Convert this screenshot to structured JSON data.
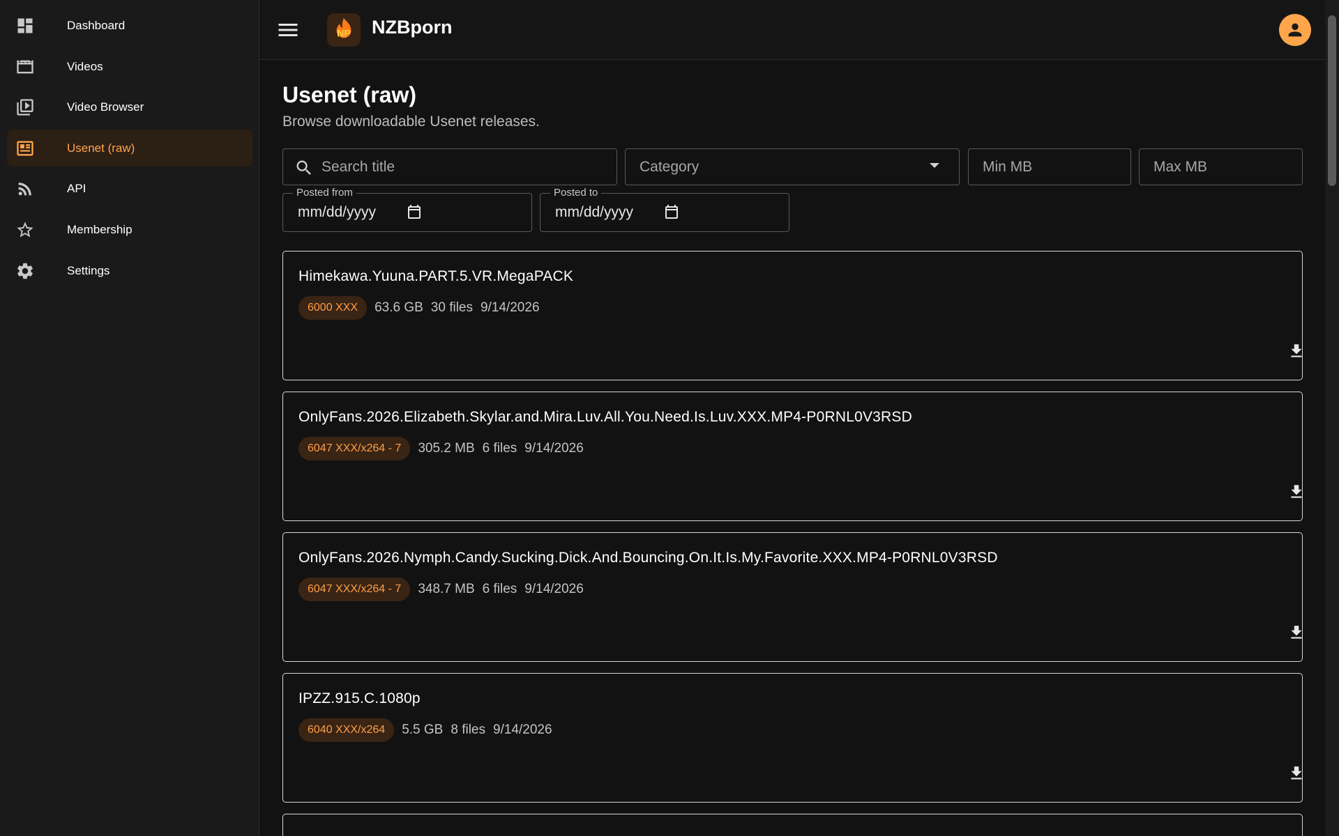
{
  "sidebar": {
    "items": [
      {
        "label": "Dashboard",
        "icon": "dashboard-icon"
      },
      {
        "label": "Videos",
        "icon": "clapperboard-icon"
      },
      {
        "label": "Video Browser",
        "icon": "video-library-icon"
      },
      {
        "label": "Usenet (raw)",
        "icon": "newspaper-icon",
        "active": true
      },
      {
        "label": "API",
        "icon": "rss-icon"
      },
      {
        "label": "Membership",
        "icon": "star-icon"
      },
      {
        "label": "Settings",
        "icon": "gear-icon"
      }
    ]
  },
  "header": {
    "brand": "NZBporn",
    "logo_text": "NP"
  },
  "page": {
    "title": "Usenet (raw)",
    "subtitle": "Browse downloadable Usenet releases."
  },
  "filters": {
    "search_placeholder": "Search title",
    "category_placeholder": "Category",
    "min_mb_placeholder": "Min MB",
    "max_mb_placeholder": "Max MB",
    "posted_from_label": "Posted from",
    "posted_from_value": "mm/dd/yyyy",
    "posted_to_label": "Posted to",
    "posted_to_value": "mm/dd/yyyy"
  },
  "releases": [
    {
      "title": "Himekawa.Yuuna.PART.5.VR.MegaPACK",
      "category": "6000 XXX",
      "size": "63.6 GB",
      "files": "30 files",
      "date": "9/14/2026"
    },
    {
      "title": "OnlyFans.2026.Elizabeth.Skylar.and.Mira.Luv.All.You.Need.Is.Luv.XXX.MP4-P0RNL0V3RSD",
      "category": "6047 XXX/x264 - 7",
      "size": "305.2 MB",
      "files": "6 files",
      "date": "9/14/2026"
    },
    {
      "title": "OnlyFans.2026.Nymph.Candy.Sucking.Dick.And.Bouncing.On.It.Is.My.Favorite.XXX.MP4-P0RNL0V3RSD",
      "category": "6047 XXX/x264 - 7",
      "size": "348.7 MB",
      "files": "6 files",
      "date": "9/14/2026"
    },
    {
      "title": "IPZZ.915.C.1080p",
      "category": "6040 XXX/x264",
      "size": "5.5 GB",
      "files": "8 files",
      "date": "9/14/2026"
    }
  ],
  "colors": {
    "accent": "#ffa54c",
    "badge_bg": "#3a2414",
    "background": "#121212",
    "sidebar_bg": "#1a1a1a"
  }
}
